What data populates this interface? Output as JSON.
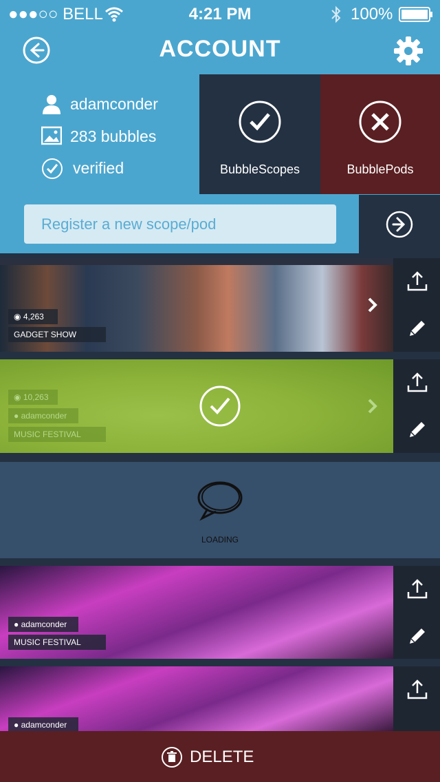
{
  "status": {
    "carrier": "●●●○○ BELL",
    "time": "4:21 PM",
    "battery": "100%"
  },
  "header": {
    "title": "ACCOUNT"
  },
  "profile": {
    "username": "adamconder",
    "bubbles": "283 bubbles",
    "verified": "verified"
  },
  "tiles": {
    "scopes_label": "BubbleScopes",
    "pods_label": "BubblePods"
  },
  "register": {
    "placeholder": "Register a new scope/pod"
  },
  "rows": [
    {
      "views": "4,263",
      "title": "GADGET SHOW"
    },
    {
      "views": "10,263",
      "user": "adamconder",
      "title": "MUSIC FESTIVAL"
    },
    {
      "user": "adamconder",
      "title": "MUSIC FESTIVAL"
    },
    {
      "user": "adamconder"
    }
  ],
  "loading": {
    "label": "LOADING"
  },
  "footer": {
    "delete_label": "DELETE"
  },
  "colors": {
    "accent": "#4ba6cf",
    "dark": "#243142",
    "danger": "#5a1f22",
    "selected": "#8db33a"
  }
}
